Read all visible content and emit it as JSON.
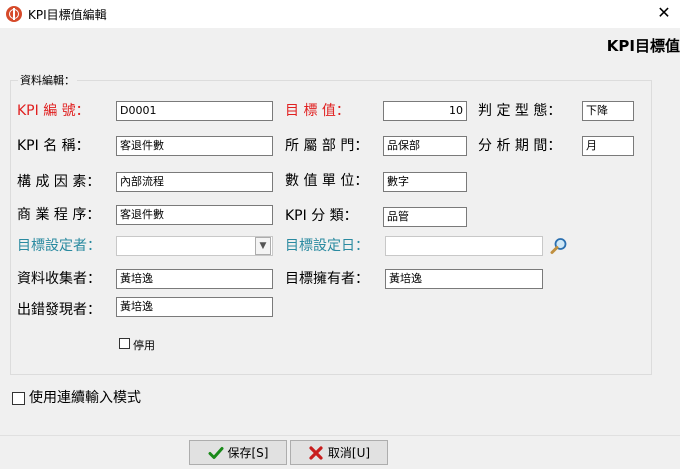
{
  "window": {
    "title": "KPI目標值編輯",
    "close_glyph": "✕"
  },
  "header": {
    "title": "KPI目標值"
  },
  "group": {
    "title": "資料編輯："
  },
  "fields": {
    "kpi_code": {
      "label": "KPI 編 號：",
      "value": "D0001"
    },
    "target_value": {
      "label": "目 標 值：",
      "value": "10"
    },
    "judge_type": {
      "label": "判 定 型 態：",
      "value": "下降"
    },
    "kpi_name": {
      "label": "KPI 名 稱：",
      "value": "客退件數"
    },
    "department": {
      "label": "所 屬 部 門：",
      "value": "品保部"
    },
    "analysis_period": {
      "label": "分 析 期 間：",
      "value": "月"
    },
    "factor": {
      "label": "構 成 因 素：",
      "value": "內部流程"
    },
    "unit": {
      "label": "數 值 單 位：",
      "value": "數字"
    },
    "business_process": {
      "label": "商 業 程 序：",
      "value": "客退件數"
    },
    "kpi_category": {
      "label": "KPI 分 類：",
      "value": "品管"
    },
    "target_setter": {
      "label": "目標設定者：",
      "value": ""
    },
    "target_date": {
      "label": "目標設定日：",
      "value": ""
    },
    "data_collector": {
      "label": "資料收集者：",
      "value": "黃培逸"
    },
    "target_owner": {
      "label": "目標擁有者：",
      "value": "黃培逸"
    },
    "error_finder": {
      "label": "出錯發現者：",
      "value": "黃培逸"
    }
  },
  "disabled_checkbox": {
    "label": "停用",
    "checked": false
  },
  "continuous_mode": {
    "label": "使用連續輸入模式",
    "checked": false
  },
  "buttons": {
    "save": "保存[S]",
    "cancel": "取消[U]"
  },
  "colors": {
    "required_label": "#e02020",
    "lookup_label": "#2a8aa0",
    "save_icon": "#1a8a1a",
    "cancel_icon": "#c81e1e"
  },
  "icons": {
    "app": "app-globe-icon",
    "search": "magnifier-icon",
    "save": "checkmark-icon",
    "cancel": "x-icon",
    "dropdown": "chevron-down-icon"
  }
}
